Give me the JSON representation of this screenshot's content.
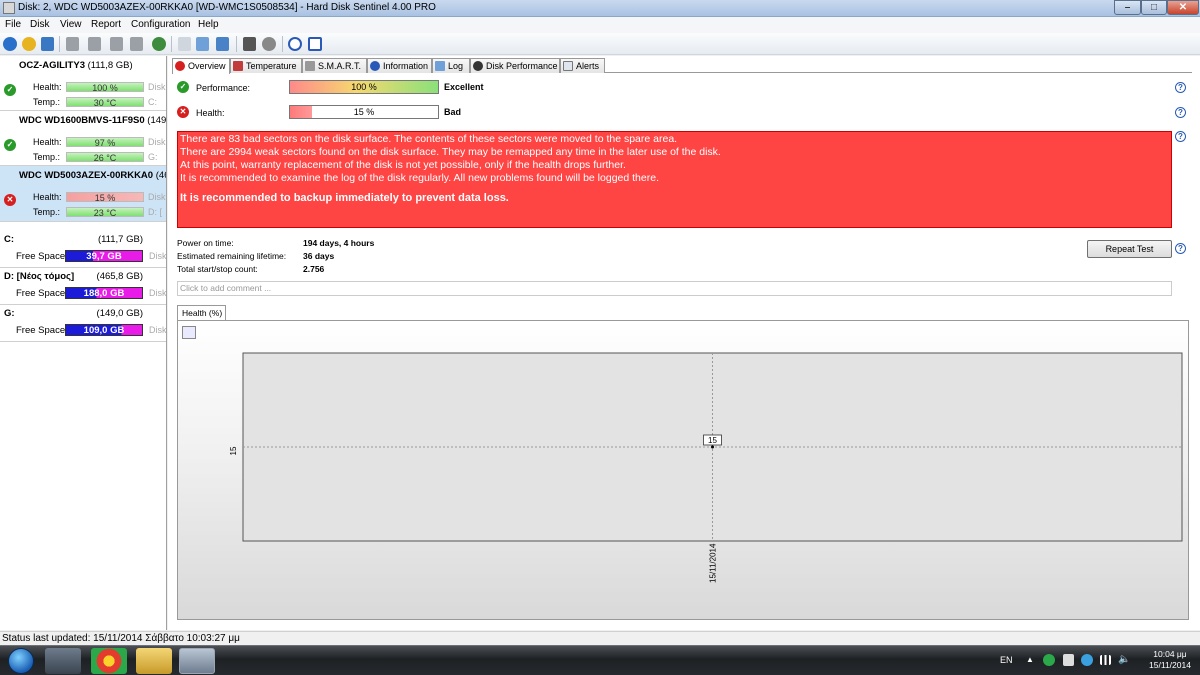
{
  "window": {
    "title": "Disk: 2, WDC WD5003AZEX-00RKKA0 [WD-WMC1S0508534]  -  Hard Disk Sentinel 4.00 PRO"
  },
  "menu": [
    "File",
    "Disk",
    "View",
    "Report",
    "Configuration",
    "Help"
  ],
  "disks": [
    {
      "name": "OCZ-AGILITY3",
      "capacity": "(111,8 GB)",
      "status": "ok",
      "health_label": "Health:",
      "health": "100 %",
      "health_fraction": 1.0,
      "temp_label": "Temp.:",
      "temp": "30 °C",
      "side1": "Disk",
      "side2": "C:"
    },
    {
      "name": "WDC WD1600BMVS-11F9S0",
      "capacity": "(149",
      "status": "ok",
      "health_label": "Health:",
      "health": "97 %",
      "health_fraction": 0.97,
      "temp_label": "Temp.:",
      "temp": "26 °C",
      "side1": "Disk",
      "side2": "G:"
    },
    {
      "name": "WDC WD5003AZEX-00RKKA0",
      "capacity": "(46",
      "status": "bad",
      "health_label": "Health:",
      "health": "15 %",
      "health_fraction": 0.15,
      "temp_label": "Temp.:",
      "temp": "23 °C",
      "side1": "Disk",
      "side2": "D: ["
    }
  ],
  "partitions": [
    {
      "letter": "C:",
      "size": "(111,7 GB)",
      "free_label": "Free Space",
      "free": "39,7 GB",
      "free_fraction": 0.355,
      "side": "Disk"
    },
    {
      "letter": "D: [Νέος τόμος]",
      "size": "(465,8 GB)",
      "free_label": "Free Space",
      "free": "188,0 GB",
      "free_fraction": 0.404,
      "side": "Disk"
    },
    {
      "letter": "G:",
      "size": "(149,0 GB)",
      "free_label": "Free Space",
      "free": "109,0 GB",
      "free_fraction": 0.731,
      "side": "Disk"
    }
  ],
  "tabs": [
    "Overview",
    "Temperature",
    "S.M.A.R.T.",
    "Information",
    "Log",
    "Disk Performance",
    "Alerts"
  ],
  "overview": {
    "performance_label": "Performance:",
    "performance_value": "100 %",
    "performance_fraction": 1.0,
    "performance_rating": "Excellent",
    "health_label": "Health:",
    "health_value": "15 %",
    "health_fraction": 0.15,
    "health_rating": "Bad",
    "alert_lines": [
      "There are 83 bad sectors on the disk surface. The contents of these sectors were moved to the spare area.",
      "There are 2994 weak sectors found on the disk surface. They may be remapped any time in the later use of the disk.",
      "At this point, warranty replacement of the disk is not yet possible, only if the health drops further.",
      "It is recommended to examine the log of the disk regularly. All new problems found will be logged there."
    ],
    "alert_strong": "It is recommended to backup immediately to prevent data loss.",
    "power_on_label": "Power on time:",
    "power_on_value": "194 days, 4 hours",
    "remaining_label": "Estimated remaining lifetime:",
    "remaining_value": "36 days",
    "startstop_label": "Total start/stop count:",
    "startstop_value": "2.756",
    "repeat_button": "Repeat Test",
    "comment_placeholder": "Click to add comment ...",
    "graph_tab": "Health (%)"
  },
  "chart_data": {
    "type": "line",
    "title": "",
    "xlabel": "",
    "ylabel": "",
    "x": [
      "15/11/2014"
    ],
    "series": [
      {
        "values": [
          15
        ]
      }
    ],
    "y_tick_labels": [
      "15"
    ],
    "data_labels": [
      "15"
    ],
    "grid": true
  },
  "statusbar": {
    "text": "Status last updated: 15/11/2014 Σάββατο 10:03:27 μμ"
  },
  "taskbar": {
    "lang": "EN",
    "time": "10:04 μμ",
    "date": "15/11/2014"
  },
  "colors": {
    "alert_bg": "#ff4444",
    "ok": "#2a9a2a",
    "bad": "#d62020",
    "free_used": "#e81be8",
    "free_free": "#1b1bd8"
  }
}
